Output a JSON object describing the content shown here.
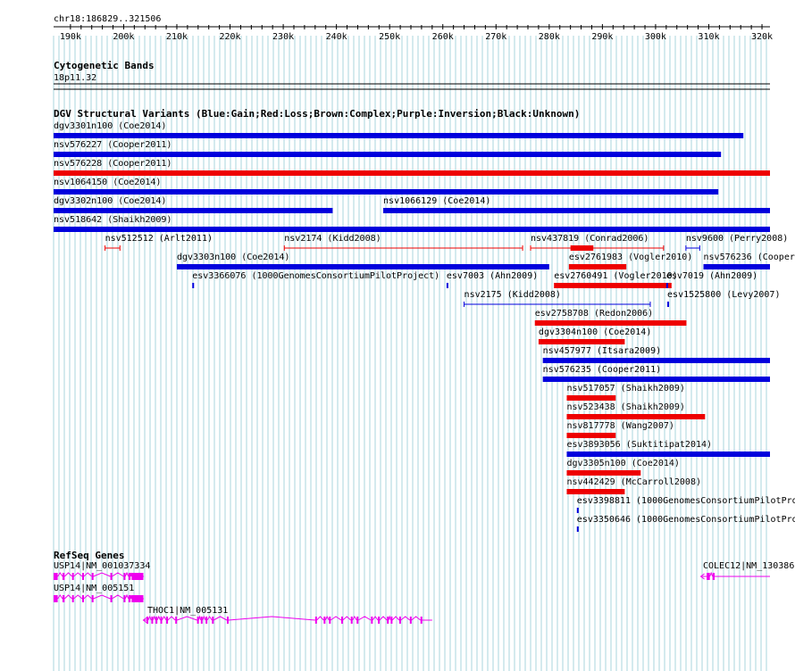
{
  "header": {
    "location": "chr18:186829..321506",
    "ticks": [
      "190k",
      "200k",
      "210k",
      "220k",
      "230k",
      "240k",
      "250k",
      "260k",
      "270k",
      "280k",
      "290k",
      "300k",
      "310k",
      "320k"
    ]
  },
  "colors": {
    "gain": "#0000dd",
    "loss": "#ee0000",
    "exon": "#ee00ee",
    "grid": "#aad4dd"
  },
  "cytoband": {
    "title": "Cytogenetic Bands",
    "band": "18p11.32"
  },
  "dgv": {
    "title": "DGV Structural Variants (Blue:Gain;Red:Loss;Brown:Complex;Purple:Inversion;Black:Unknown)",
    "items": [
      {
        "label": "dgv3301n100 (Coe2014)",
        "type": "gain",
        "start": 186829,
        "end": 316500,
        "style": "bar"
      },
      {
        "label": "nsv576227 (Cooper2011)",
        "type": "gain",
        "start": 186829,
        "end": 312300,
        "style": "bar"
      },
      {
        "label": "nsv576228 (Cooper2011)",
        "type": "loss",
        "start": 186829,
        "end": 321506,
        "style": "bar"
      },
      {
        "label": "nsv1064150 (Coe2014)",
        "type": "gain",
        "start": 186829,
        "end": 311800,
        "style": "bar"
      },
      {
        "label": "dgv3302n100 (Coe2014)",
        "type": "gain",
        "start": 186829,
        "end": 239300,
        "style": "bar"
      },
      {
        "label": "nsv1066129 (Coe2014)",
        "type": "gain",
        "start": 248800,
        "end": 321506,
        "style": "bar"
      },
      {
        "label": "nsv518642 (Shaikh2009)",
        "type": "gain",
        "start": 186829,
        "end": 321506,
        "style": "bar"
      },
      {
        "label": "nsv512512 (Arlt2011)",
        "type": "loss",
        "start": 196500,
        "end": 199300,
        "style": "line"
      },
      {
        "label": "nsv2174 (Kidd2008)",
        "type": "loss",
        "start": 230200,
        "end": 275000,
        "style": "line"
      },
      {
        "label": "nsv437819 (Conrad2006)",
        "type": "loss",
        "start": 276500,
        "end": 301500,
        "style": "line",
        "thick": [
          284000,
          288300
        ]
      },
      {
        "label": "nsv9600 (Perry2008)",
        "type": "gain",
        "start": 305700,
        "end": 308300,
        "style": "line"
      },
      {
        "label": "dgv3303n100 (Coe2014)",
        "type": "gain",
        "start": 210000,
        "end": 280000,
        "style": "bar"
      },
      {
        "label": "esv2761983 (Vogler2010)",
        "type": "loss",
        "start": 283700,
        "end": 294500,
        "style": "bar"
      },
      {
        "label": "nsv576236 (Cooper2011)",
        "type": "gain",
        "start": 309000,
        "end": 321506,
        "style": "bar"
      },
      {
        "label": "esv3366076 (1000GenomesConsortiumPilotProject)",
        "type": "gain",
        "start": 212900,
        "end": 213100,
        "style": "tick"
      },
      {
        "label": "esv7003 (Ahn2009)",
        "type": "gain",
        "start": 260700,
        "end": 260900,
        "style": "tick"
      },
      {
        "label": "esv2760491 (Vogler2010)",
        "type": "loss",
        "start": 280900,
        "end": 303000,
        "style": "bar"
      },
      {
        "label": "esv7019 (Ahn2009)",
        "type": "gain",
        "start": 302000,
        "end": 302300,
        "style": "tick"
      },
      {
        "label": "nsv2175 (Kidd2008)",
        "type": "gain",
        "start": 264000,
        "end": 299000,
        "style": "line"
      },
      {
        "label": "esv1525800 (Levy2007)",
        "type": "gain",
        "start": 302200,
        "end": 302500,
        "style": "tick"
      },
      {
        "label": "esv2758708 (Redon2006)",
        "type": "loss",
        "start": 277300,
        "end": 305800,
        "style": "bar"
      },
      {
        "label": "dgv3304n100 (Coe2014)",
        "type": "loss",
        "start": 278000,
        "end": 294200,
        "style": "bar"
      },
      {
        "label": "nsv457977 (Itsara2009)",
        "type": "gain",
        "start": 278800,
        "end": 321506,
        "style": "bar"
      },
      {
        "label": "nsv576235 (Cooper2011)",
        "type": "gain",
        "start": 278800,
        "end": 321506,
        "style": "bar"
      },
      {
        "label": "nsv517057 (Shaikh2009)",
        "type": "loss",
        "start": 283300,
        "end": 292500,
        "style": "bar"
      },
      {
        "label": "nsv523438 (Shaikh2009)",
        "type": "loss",
        "start": 283300,
        "end": 309300,
        "style": "bar"
      },
      {
        "label": "nsv817778 (Wang2007)",
        "type": "loss",
        "start": 283300,
        "end": 292500,
        "style": "bar"
      },
      {
        "label": "esv3893056 (Suktitipat2014)",
        "type": "gain",
        "start": 283300,
        "end": 321506,
        "style": "bar"
      },
      {
        "label": "dgv3305n100 (Coe2014)",
        "type": "loss",
        "start": 283300,
        "end": 297200,
        "style": "bar"
      },
      {
        "label": "nsv442429 (McCarroll2008)",
        "type": "loss",
        "start": 283300,
        "end": 294200,
        "style": "bar"
      },
      {
        "label": "esv3398811 (1000GenomesConsortiumPilotProject)",
        "type": "gain",
        "start": 285200,
        "end": 285500,
        "style": "tick"
      },
      {
        "label": "esv3350646 (1000GenomesConsortiumPilotProject)",
        "type": "gain",
        "start": 285200,
        "end": 285500,
        "style": "tick"
      }
    ]
  },
  "refseq": {
    "title": "RefSeq Genes",
    "genes": [
      {
        "label": "USP14|NM_001037334",
        "start": 186829,
        "end": 203700,
        "exons": [
          [
            186829,
            187600
          ],
          [
            188500,
            188900
          ],
          [
            190300,
            190600
          ],
          [
            192200,
            192500
          ],
          [
            194000,
            194300
          ],
          [
            197500,
            197800
          ],
          [
            200000,
            200300
          ],
          [
            200900,
            201300
          ],
          [
            201500,
            203700
          ]
        ],
        "strand": "+"
      },
      {
        "label": "USP14|NM_005151",
        "start": 186829,
        "end": 203700,
        "exons": [
          [
            186829,
            187600
          ],
          [
            188500,
            188900
          ],
          [
            190300,
            190600
          ],
          [
            192200,
            192500
          ],
          [
            194000,
            194300
          ],
          [
            197500,
            197800
          ],
          [
            200000,
            200300
          ],
          [
            200900,
            201300
          ],
          [
            201500,
            203700
          ]
        ],
        "strand": "+"
      },
      {
        "label": "THOC1|NM_005131",
        "start": 203700,
        "end": 258000,
        "exons": [
          [
            204300,
            204600
          ],
          [
            205200,
            205500
          ],
          [
            206000,
            206300
          ],
          [
            206900,
            207200
          ],
          [
            208000,
            208300
          ],
          [
            209700,
            210000
          ],
          [
            213800,
            214100
          ],
          [
            214500,
            214800
          ],
          [
            215400,
            215700
          ],
          [
            216600,
            216900
          ],
          [
            219400,
            219700
          ],
          [
            236000,
            236300
          ],
          [
            237600,
            237900
          ],
          [
            238600,
            238900
          ],
          [
            240900,
            241200
          ],
          [
            242700,
            243000
          ],
          [
            243800,
            244100
          ],
          [
            246500,
            246800
          ],
          [
            247800,
            248100
          ],
          [
            249500,
            249800
          ],
          [
            250200,
            250500
          ],
          [
            251800,
            252100
          ],
          [
            253800,
            254100
          ],
          [
            255800,
            256100
          ]
        ],
        "strand": "-"
      },
      {
        "label": "COLEC12|NM_130386",
        "start": 308500,
        "end": 321506,
        "exons": [
          [
            309600,
            310200
          ],
          [
            310700,
            311100
          ]
        ],
        "strand": "-"
      }
    ]
  }
}
